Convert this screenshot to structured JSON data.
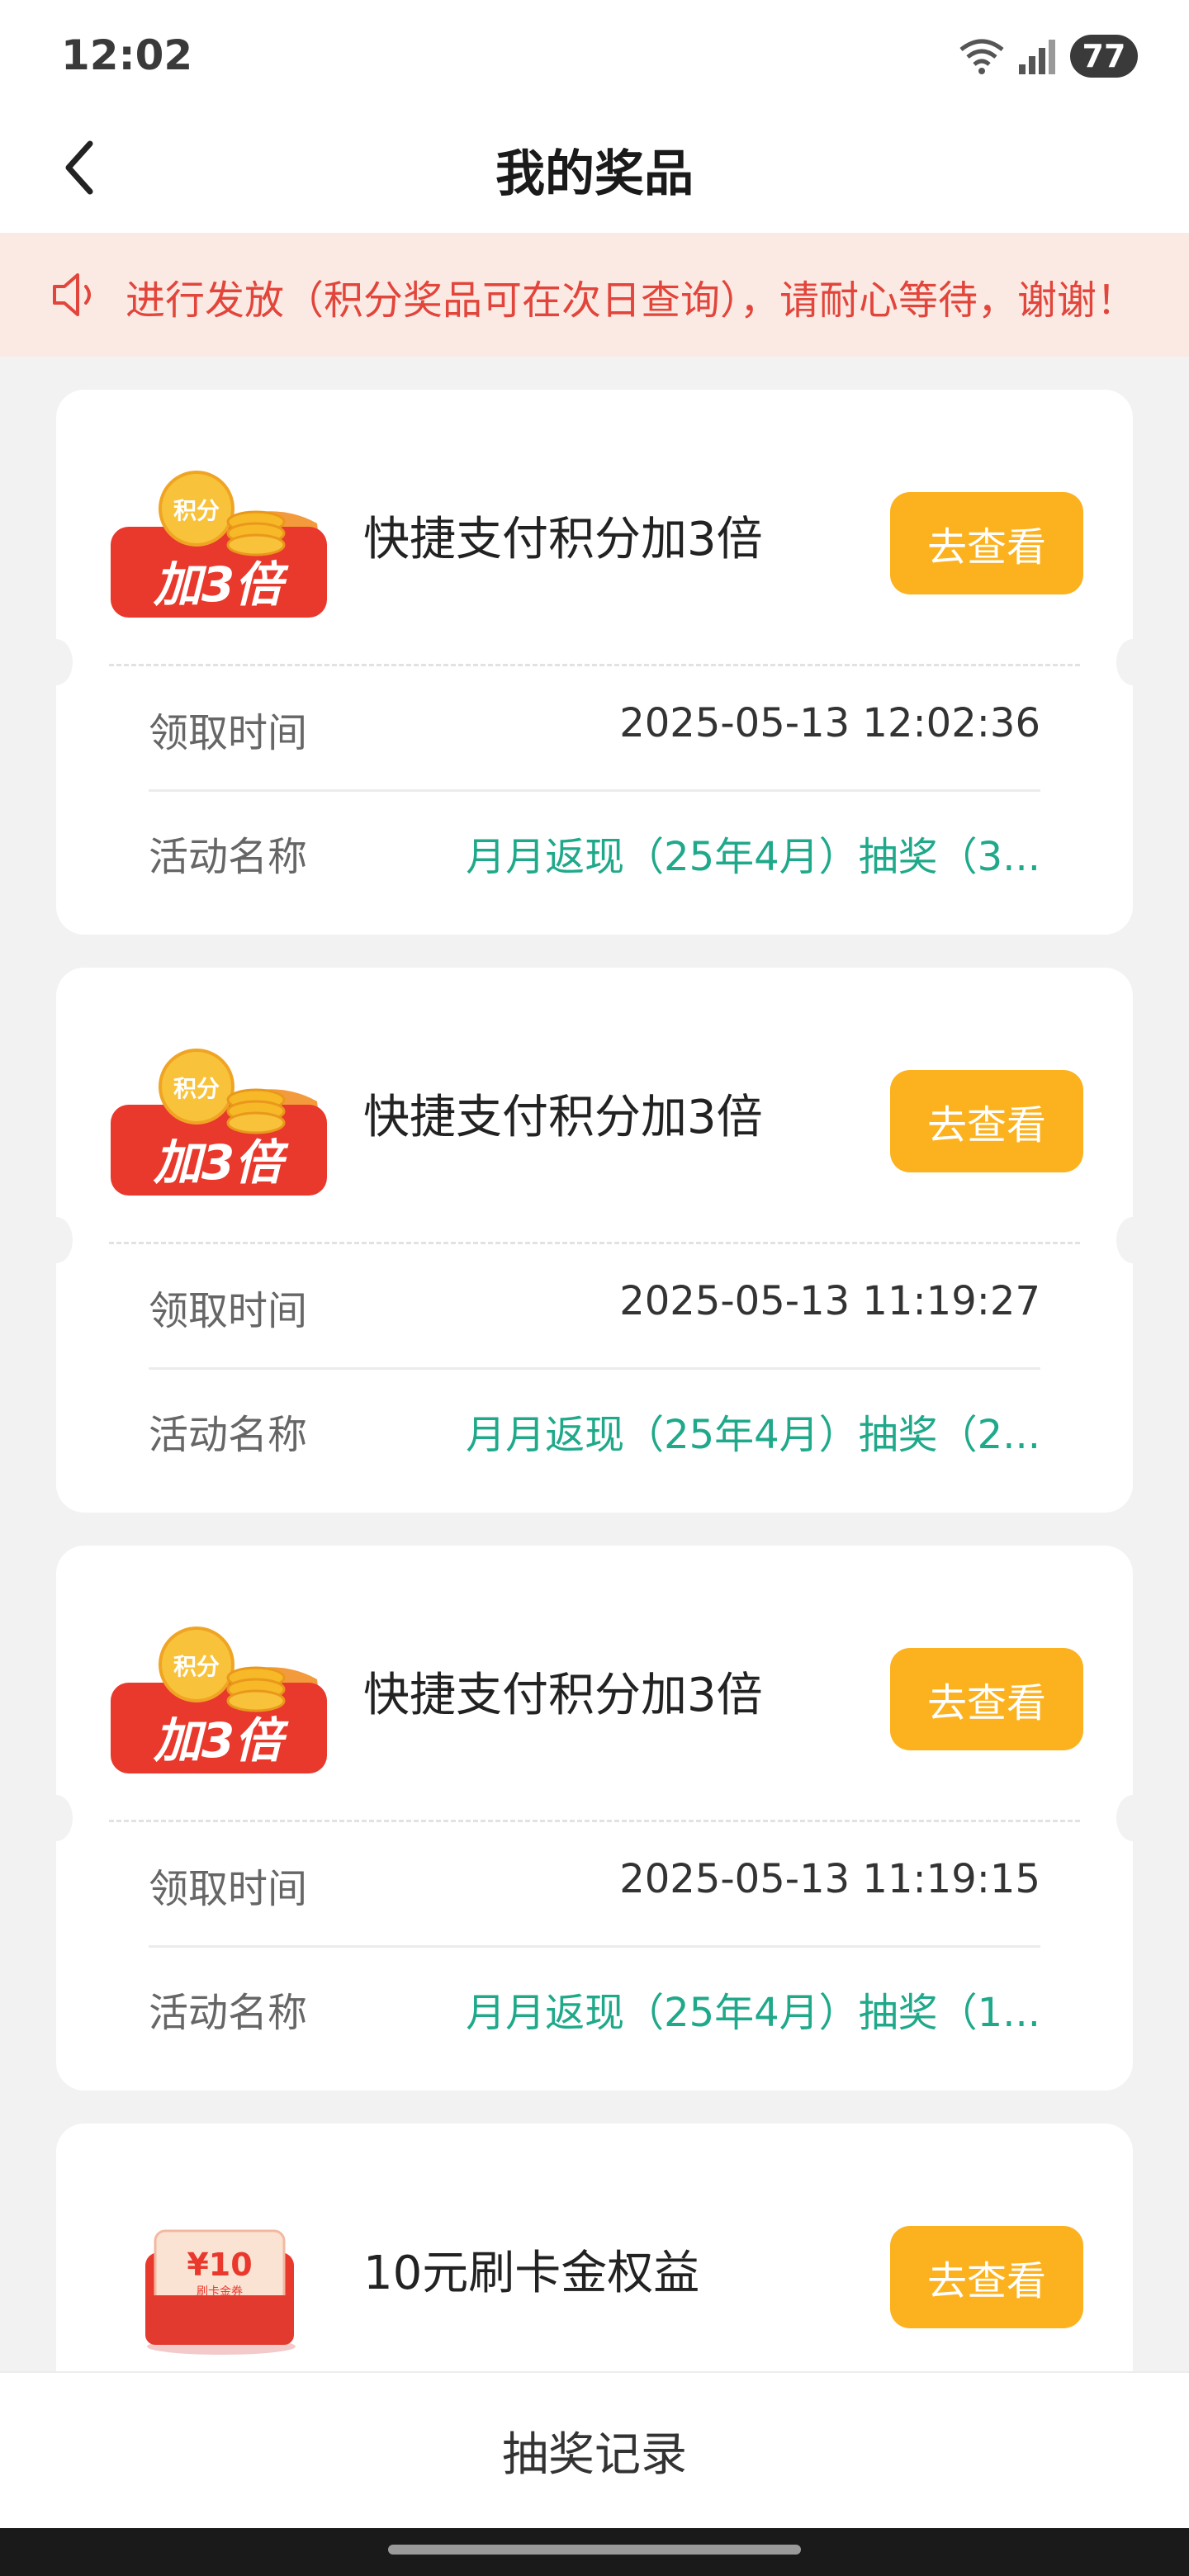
{
  "status_bar": {
    "time": "12:02",
    "battery": "77"
  },
  "header": {
    "title": "我的奖品"
  },
  "notice": {
    "text": "进行发放（积分奖品可在次日查询），请耐心等待，谢谢！"
  },
  "prizes": [
    {
      "icon_text_top": "积分",
      "icon_text_main": "加3倍",
      "name": "快捷支付积分加3倍",
      "button_label": "去查看",
      "time_label": "领取时间",
      "time_value": "2025-05-13 12:02:36",
      "activity_label": "活动名称",
      "activity_value": "月月返现（25年4月）抽奖（3..."
    },
    {
      "icon_text_top": "积分",
      "icon_text_main": "加3倍",
      "name": "快捷支付积分加3倍",
      "button_label": "去查看",
      "time_label": "领取时间",
      "time_value": "2025-05-13 11:19:27",
      "activity_label": "活动名称",
      "activity_value": "月月返现（25年4月）抽奖（2..."
    },
    {
      "icon_text_top": "积分",
      "icon_text_main": "加3倍",
      "name": "快捷支付积分加3倍",
      "button_label": "去查看",
      "time_label": "领取时间",
      "time_value": "2025-05-13 11:19:15",
      "activity_label": "活动名称",
      "activity_value": "月月返现（25年4月）抽奖（1..."
    },
    {
      "icon_text_main": "¥10",
      "icon_text_sub": "刷卡金券",
      "name": "10元刷卡金权益",
      "button_label": "去查看"
    }
  ],
  "bottom": {
    "label": "抽奖记录"
  },
  "colors": {
    "accent_orange": "#fcb21f",
    "notice_red": "#e2453b",
    "link_green": "#1fa98a",
    "badge_red": "#e8392c"
  },
  "icons": [
    "back-arrow-icon",
    "wifi-icon",
    "signal-icon",
    "speaker-icon",
    "points-triple-badge-icon",
    "card-coupon-icon"
  ]
}
